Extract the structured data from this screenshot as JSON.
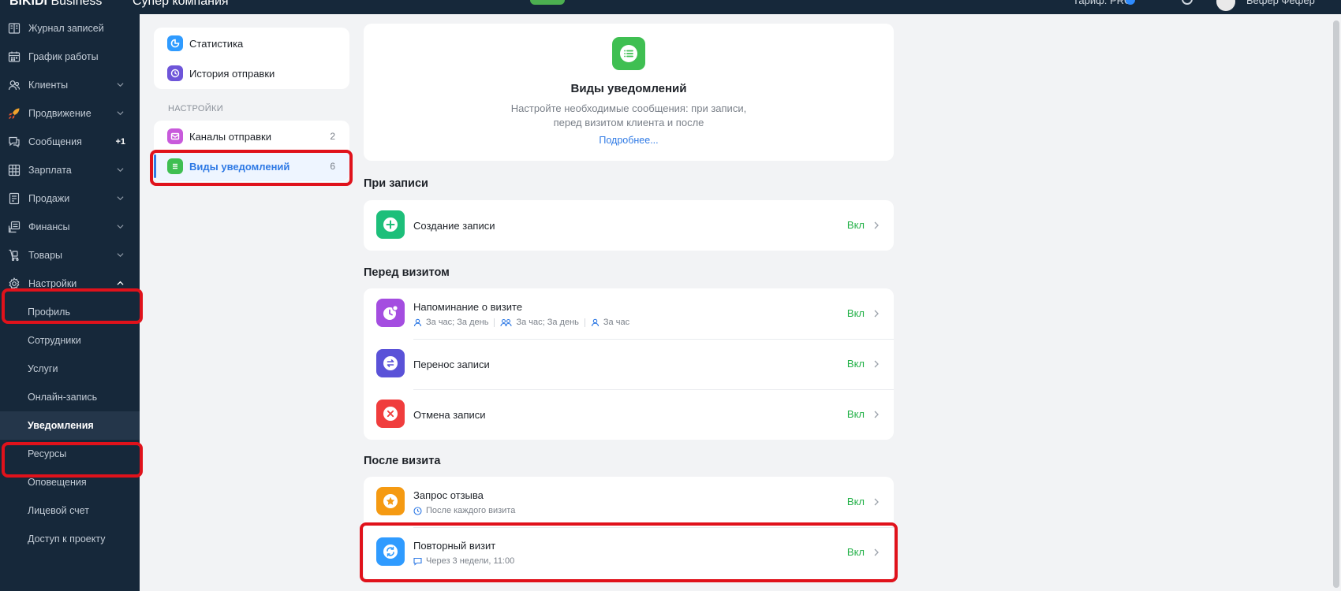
{
  "topbar": {
    "brand": "BIKIDI",
    "brand_suffix": "Business",
    "company": "Супер компания",
    "tariff": "Тариф: PRO",
    "user": "Бефер Фефер"
  },
  "sidebar": {
    "items": [
      {
        "label": "Журнал записей",
        "icon": "journal-icon"
      },
      {
        "label": "График работы",
        "icon": "calendar-icon"
      },
      {
        "label": "Клиенты",
        "icon": "clients-icon"
      },
      {
        "label": "Продвижение",
        "icon": "rocket-icon"
      },
      {
        "label": "Сообщения",
        "icon": "chat-icon",
        "badge": "+1"
      },
      {
        "label": "Зарплата",
        "icon": "salary-icon"
      },
      {
        "label": "Продажи",
        "icon": "sales-icon"
      },
      {
        "label": "Финансы",
        "icon": "finance-icon"
      },
      {
        "label": "Товары",
        "icon": "goods-icon"
      },
      {
        "label": "Настройки",
        "icon": "gear-icon"
      }
    ],
    "sub_items": [
      {
        "label": "Профиль"
      },
      {
        "label": "Сотрудники"
      },
      {
        "label": "Услуги"
      },
      {
        "label": "Онлайн-запись"
      },
      {
        "label": "Уведомления"
      },
      {
        "label": "Ресурсы"
      },
      {
        "label": "Оповещения"
      },
      {
        "label": "Лицевой счет"
      },
      {
        "label": "Доступ к проекту"
      }
    ]
  },
  "submenu": {
    "top": [
      {
        "label": "Статистика",
        "icon": "statistics-icon",
        "color": "#2f9bff"
      },
      {
        "label": "История отправки",
        "icon": "history-icon",
        "color": "#6e55d9"
      }
    ],
    "section_label": "НАСТРОЙКИ",
    "settings": [
      {
        "label": "Каналы отправки",
        "count": "2",
        "icon": "channels-icon",
        "color": "#c85adb"
      },
      {
        "label": "Виды уведомлений",
        "count": "6",
        "icon": "notification-types-icon",
        "color": "#3fbf52"
      }
    ]
  },
  "hero": {
    "title": "Виды уведомлений",
    "desc_line1": "Настройте необходимые сообщения: при записи,",
    "desc_line2": "перед визитом клиента и после",
    "link": "Подробнее..."
  },
  "sections": {
    "on_booking": {
      "title": "При записи",
      "rows": [
        {
          "title": "Создание записи",
          "status": "Вкл",
          "color": "#1dbf7a"
        }
      ]
    },
    "before_visit": {
      "title": "Перед визитом",
      "rows": [
        {
          "title": "Напоминание о визите",
          "status": "Вкл",
          "color": "#a44de0",
          "sub": [
            "За час; За день",
            "За час; За день",
            "За час"
          ]
        },
        {
          "title": "Перенос записи",
          "status": "Вкл",
          "color": "#5a52d8"
        },
        {
          "title": "Отмена записи",
          "status": "Вкл",
          "color": "#f03d3d"
        }
      ]
    },
    "after_visit": {
      "title": "После визита",
      "rows": [
        {
          "title": "Запрос отзыва",
          "status": "Вкл",
          "color": "#f59a12",
          "sub": "После каждого визита"
        },
        {
          "title": "Повторный визит",
          "status": "Вкл",
          "color": "#2f9bff",
          "sub": "Через 3 недели, 11:00"
        }
      ]
    }
  }
}
